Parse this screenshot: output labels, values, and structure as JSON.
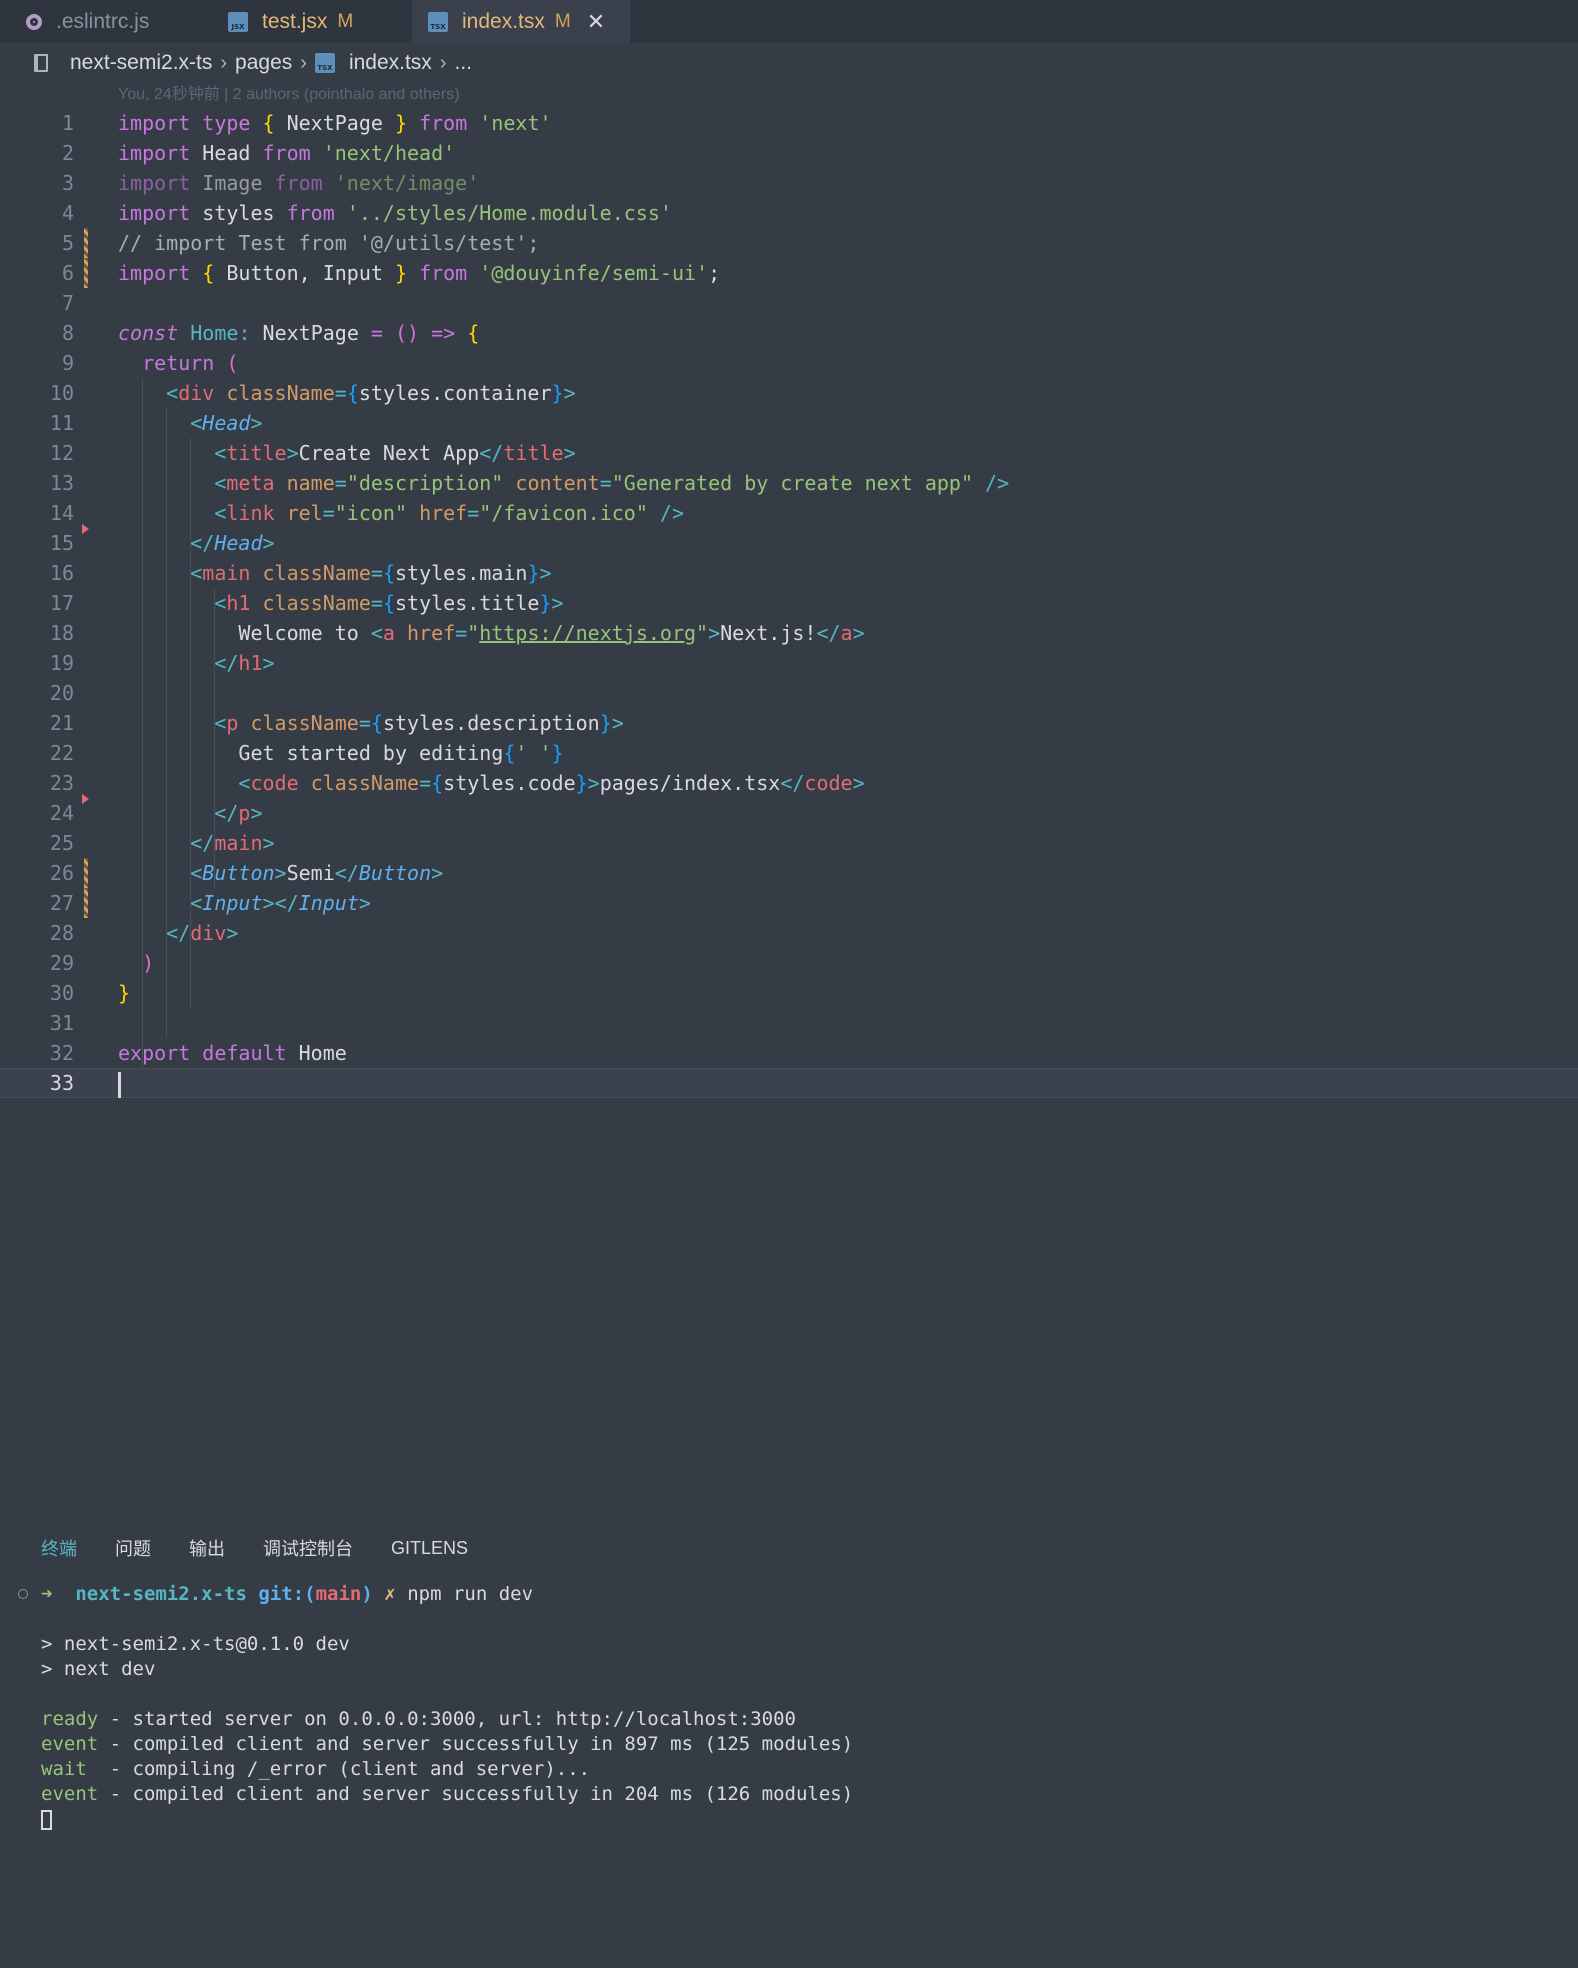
{
  "tabs": [
    {
      "label": ".eslintrc.js",
      "icon": "eslint-icon",
      "modified": "",
      "active": false
    },
    {
      "label": "test.jsx",
      "icon": "jsx-file-icon",
      "badge": "JSX",
      "modified": "M",
      "active": false
    },
    {
      "label": "index.tsx",
      "icon": "tsx-file-icon",
      "badge": "TSX",
      "modified": "M",
      "active": true,
      "close": "✕"
    }
  ],
  "breadcrumb": {
    "project": "next-semi2.x-ts",
    "folder": "pages",
    "file_badge": "TSX",
    "file": "index.tsx",
    "more": "..."
  },
  "blame": "You, 24秒钟前 | 2 authors (pointhalo and others)",
  "editor": {
    "current_line": 33,
    "lines": [
      {
        "n": "1",
        "mark": ""
      },
      {
        "n": "2",
        "mark": ""
      },
      {
        "n": "3",
        "mark": ""
      },
      {
        "n": "4",
        "mark": ""
      },
      {
        "n": "5",
        "mark": "modified"
      },
      {
        "n": "6",
        "mark": "modified"
      },
      {
        "n": "7",
        "mark": ""
      },
      {
        "n": "8",
        "mark": ""
      },
      {
        "n": "9",
        "mark": ""
      },
      {
        "n": "10",
        "mark": ""
      },
      {
        "n": "11",
        "mark": ""
      },
      {
        "n": "12",
        "mark": ""
      },
      {
        "n": "13",
        "mark": ""
      },
      {
        "n": "14",
        "mark": ""
      },
      {
        "n": "15",
        "mark": "deleted"
      },
      {
        "n": "16",
        "mark": ""
      },
      {
        "n": "17",
        "mark": ""
      },
      {
        "n": "18",
        "mark": ""
      },
      {
        "n": "19",
        "mark": ""
      },
      {
        "n": "20",
        "mark": ""
      },
      {
        "n": "21",
        "mark": ""
      },
      {
        "n": "22",
        "mark": ""
      },
      {
        "n": "23",
        "mark": ""
      },
      {
        "n": "24",
        "mark": "deleted"
      },
      {
        "n": "25",
        "mark": ""
      },
      {
        "n": "26",
        "mark": "modified"
      },
      {
        "n": "27",
        "mark": "modified"
      },
      {
        "n": "28",
        "mark": ""
      },
      {
        "n": "29",
        "mark": ""
      },
      {
        "n": "30",
        "mark": ""
      },
      {
        "n": "31",
        "mark": ""
      },
      {
        "n": "32",
        "mark": ""
      },
      {
        "n": "33",
        "mark": ""
      }
    ],
    "code": {
      "l1": [
        "import",
        "type",
        "{",
        "NextPage",
        "}",
        "from",
        "'next'"
      ],
      "l2": [
        "import",
        "Head",
        "from",
        "'next/head'"
      ],
      "l3": [
        "import",
        "Image",
        "from",
        "'next/image'"
      ],
      "l4": [
        "import",
        "styles",
        "from",
        "'../styles/Home.module.css'"
      ],
      "l5": "// import Test from '@/utils/test';",
      "l6": [
        "import",
        "{",
        "Button, Input",
        "}",
        "from",
        "'@douyinfe/semi-ui'",
        ";"
      ],
      "l8": [
        "const",
        "Home",
        ":",
        "NextPage",
        "=",
        "(",
        ")",
        "=>",
        "{"
      ],
      "l9": [
        "return",
        "("
      ],
      "l10": [
        "<",
        "div",
        "className",
        "=",
        "{",
        "styles.container",
        "}",
        ">"
      ],
      "l11": [
        "<",
        "Head",
        ">"
      ],
      "l12": [
        "<",
        "title",
        ">",
        "Create Next App",
        "</",
        "title",
        ">"
      ],
      "l13": [
        "<",
        "meta",
        "name",
        "=",
        "\"description\"",
        "content",
        "=",
        "\"Generated by create next app\"",
        "/>"
      ],
      "l14": [
        "<",
        "link",
        "rel",
        "=",
        "\"icon\"",
        "href",
        "=",
        "\"/favicon.ico\"",
        "/>"
      ],
      "l15": [
        "</",
        "Head",
        ">"
      ],
      "l16": [
        "<",
        "main",
        "className",
        "=",
        "{",
        "styles.main",
        "}",
        ">"
      ],
      "l17": [
        "<",
        "h1",
        "className",
        "=",
        "{",
        "styles.title",
        "}",
        ">"
      ],
      "l18": [
        "Welcome to",
        "<",
        "a",
        "href",
        "=",
        "\"",
        "https://nextjs.org",
        "\"",
        ">",
        "Next.js!",
        "</",
        "a",
        ">"
      ],
      "l19": [
        "</",
        "h1",
        ">"
      ],
      "l21": [
        "<",
        "p",
        "className",
        "=",
        "{",
        "styles.description",
        "}",
        ">"
      ],
      "l22": [
        "Get started by editing",
        "{",
        "' '",
        "}"
      ],
      "l23": [
        "<",
        "code",
        "className",
        "=",
        "{",
        "styles.code",
        "}",
        ">",
        "pages/index.tsx",
        "</",
        "code",
        ">"
      ],
      "l24": [
        "</",
        "p",
        ">"
      ],
      "l25": [
        "</",
        "main",
        ">"
      ],
      "l26": [
        "<",
        "Button",
        ">",
        "Semi",
        "</",
        "Button",
        ">"
      ],
      "l27": [
        "<",
        "Input",
        ">",
        "</",
        "Input",
        ">"
      ],
      "l28": [
        "</",
        "div",
        ">"
      ],
      "l29": [
        ")"
      ],
      "l30": [
        "}"
      ],
      "l32": [
        "export",
        "default",
        "Home"
      ]
    }
  },
  "panel": {
    "tabs": [
      "终端",
      "问题",
      "输出",
      "调试控制台",
      "GITLENS"
    ]
  },
  "terminal": {
    "prompt_arrow": "➜",
    "prompt_dir": "next-semi2.x-ts",
    "git_label": "git:",
    "git_open": "(",
    "branch": "main",
    "git_close": ")",
    "dirty": "✗",
    "command": "npm run dev",
    "out1": "> next-semi2.x-ts@0.1.0 dev",
    "out2": "> next dev",
    "log": [
      {
        "level": "ready",
        "pad": " ",
        "msg": "- started server on 0.0.0.0:3000, url: http://localhost:3000"
      },
      {
        "level": "event",
        "pad": " ",
        "msg": "- compiled client and server successfully in 897 ms (125 modules)"
      },
      {
        "level": "wait",
        "pad": "  ",
        "msg": "- compiling /_error (client and server)..."
      },
      {
        "level": "event",
        "pad": " ",
        "msg": "- compiled client and server successfully in 204 ms (126 modules)"
      }
    ]
  }
}
